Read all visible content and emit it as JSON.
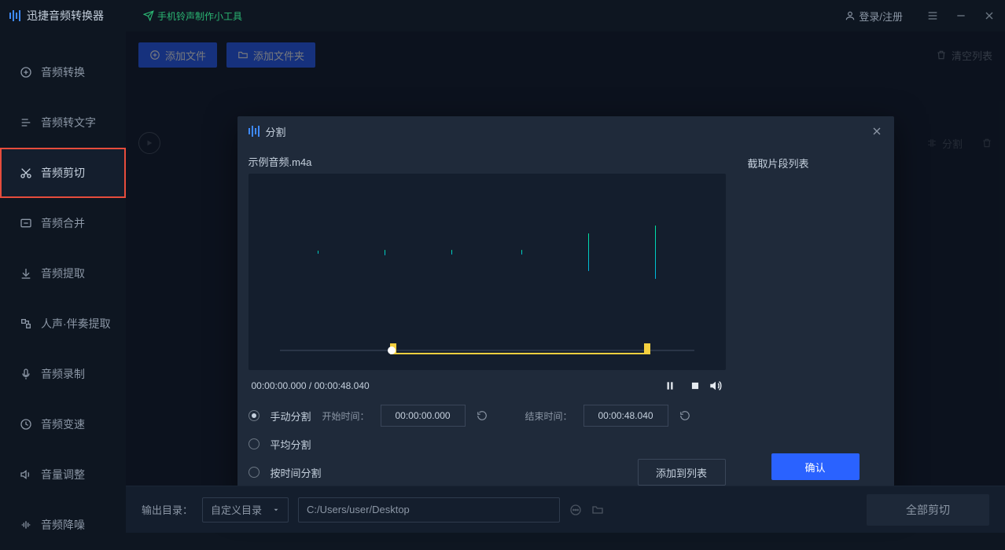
{
  "titlebar": {
    "app_name": "迅捷音频转换器",
    "tool_link": "手机铃声制作小工具",
    "login": "登录/注册"
  },
  "sidebar": {
    "items": [
      {
        "label": "音频转换",
        "icon": "convert-icon"
      },
      {
        "label": "音频转文字",
        "icon": "transcribe-icon"
      },
      {
        "label": "音频剪切",
        "icon": "cut-icon"
      },
      {
        "label": "音频合并",
        "icon": "merge-icon"
      },
      {
        "label": "音频提取",
        "icon": "extract-icon"
      },
      {
        "label": "人声·伴奏提取",
        "icon": "vocal-icon"
      },
      {
        "label": "音频录制",
        "icon": "record-icon"
      },
      {
        "label": "音频变速",
        "icon": "speed-icon"
      },
      {
        "label": "音量调整",
        "icon": "volume-icon"
      },
      {
        "label": "音频降噪",
        "icon": "denoise-icon"
      }
    ],
    "active_index": 2
  },
  "toolbar": {
    "add_file": "添加文件",
    "add_folder": "添加文件夹",
    "clear_list": "清空列表"
  },
  "bg_row": {
    "split_label": "分割"
  },
  "modal": {
    "title": "分割",
    "filename": "示例音频.m4a",
    "segment_list_label": "截取片段列表",
    "time_current": "00:00:00.000",
    "time_total": "00:00:48.040",
    "time_sep": " / ",
    "manual_split": "手动分割",
    "avg_split": "平均分割",
    "by_time_split": "按时间分割",
    "start_time_label": "开始时间：",
    "end_time_label": "结束时间：",
    "start_time_value": "00:00:00.000",
    "end_time_value": "00:00:48.040",
    "add_to_list": "添加到列表",
    "confirm": "确认"
  },
  "bottombar": {
    "output_dir_label": "输出目录：",
    "select_value": "自定义目录",
    "path_value": "C:/Users/user/Desktop",
    "cut_all": "全部剪切"
  }
}
